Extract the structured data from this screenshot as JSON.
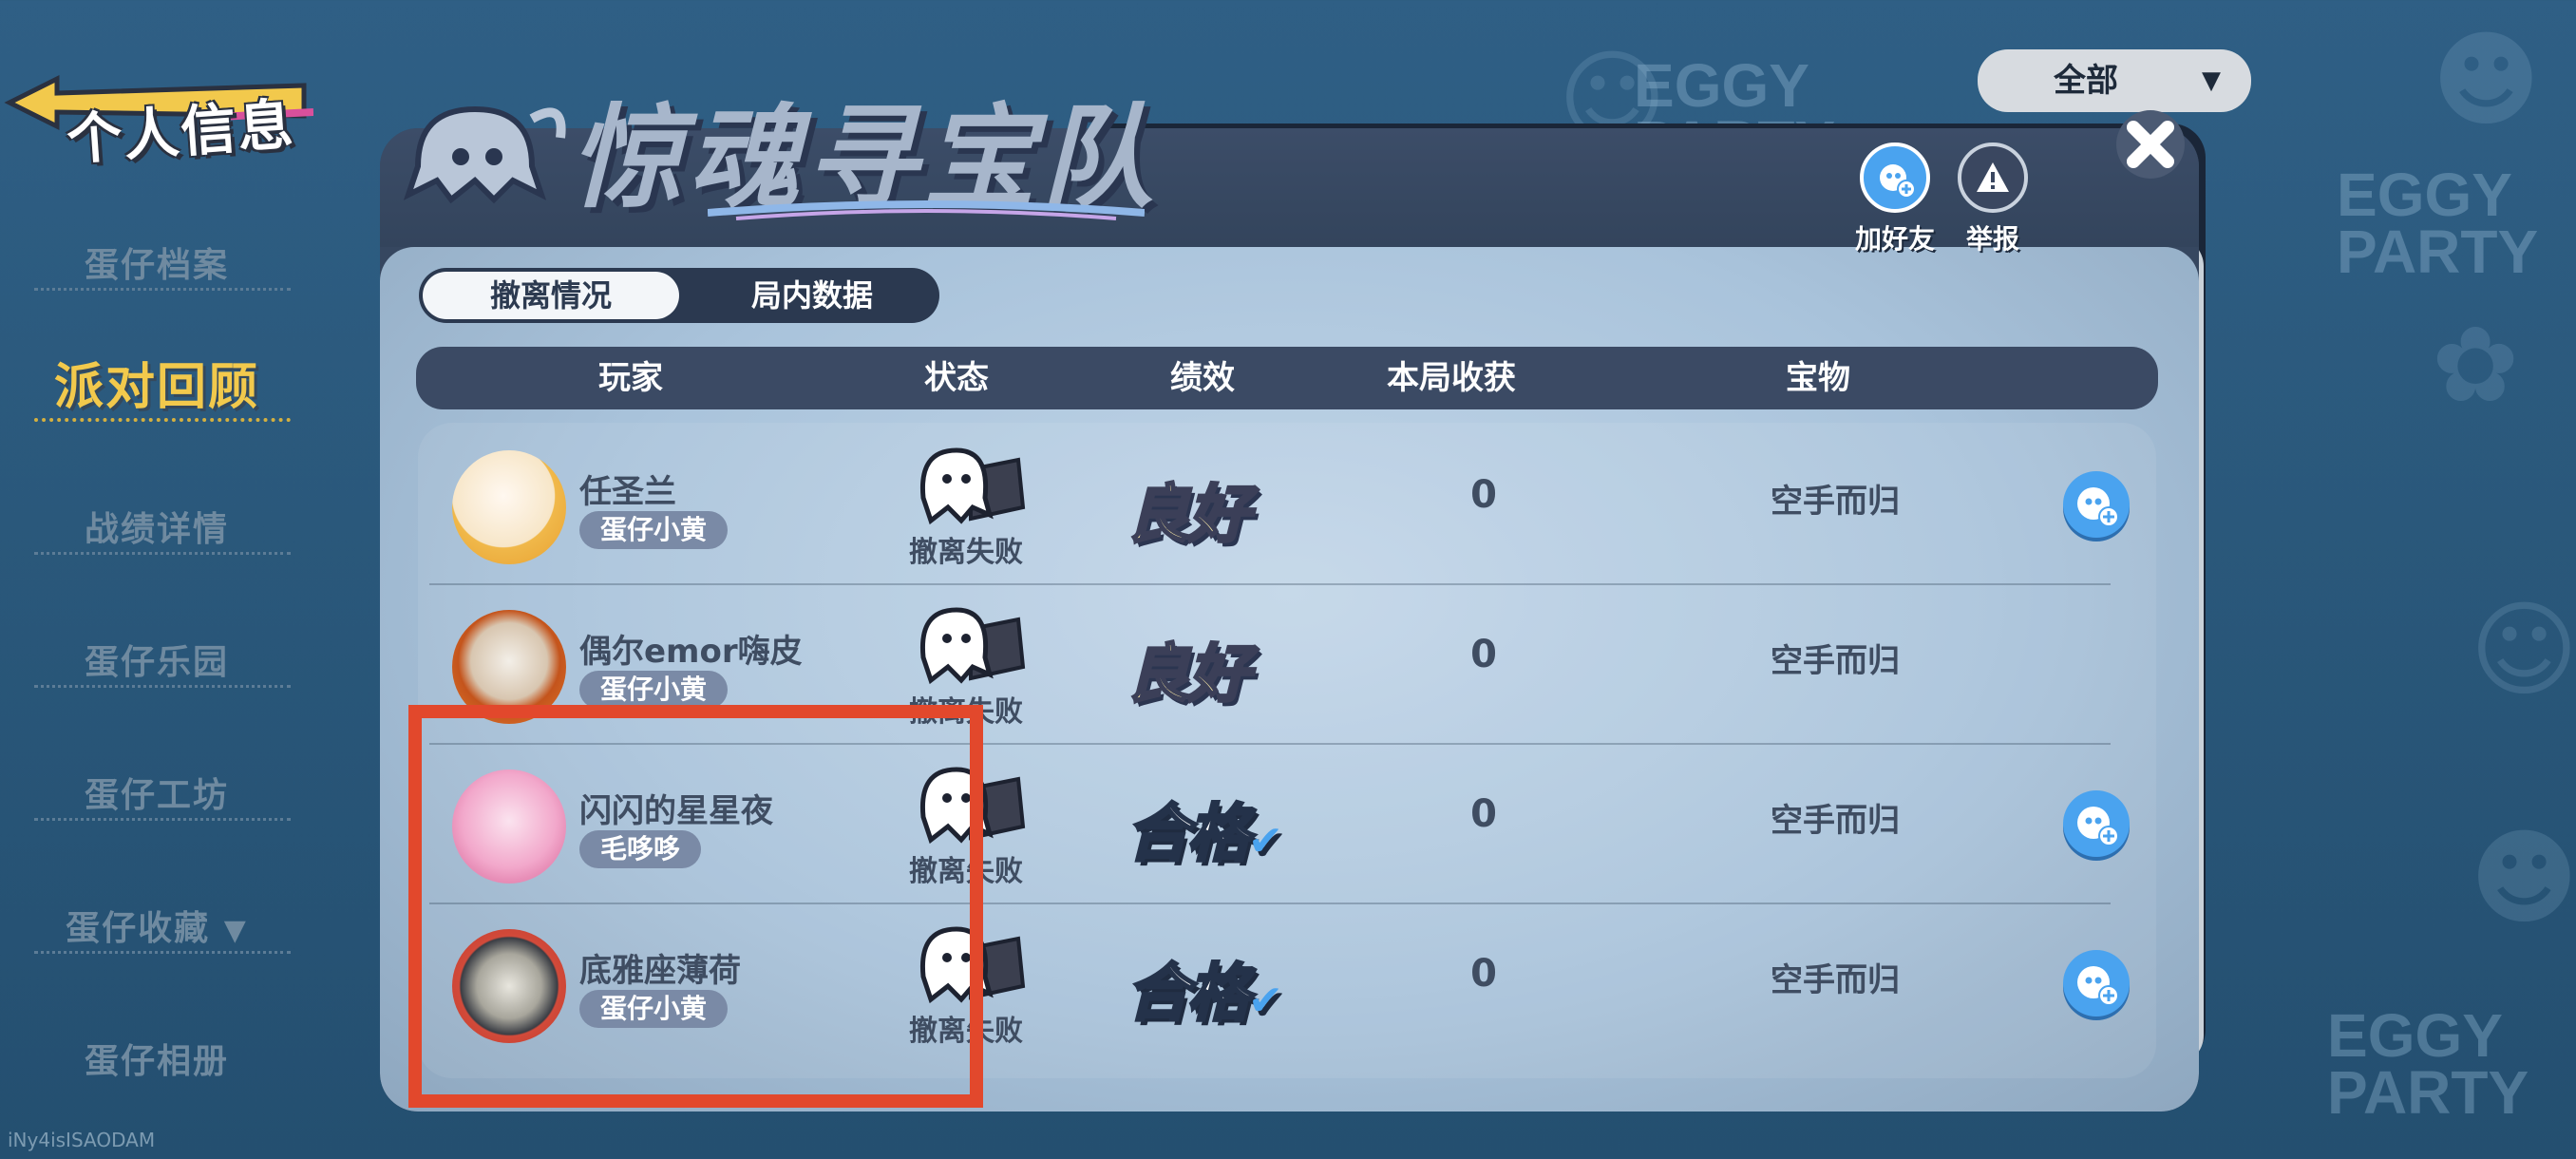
{
  "header": {
    "back_label": "个人信息",
    "game_title": "惊魂寻宝队",
    "filter": {
      "selected": "全部"
    }
  },
  "sidebar": {
    "items": [
      {
        "label": "蛋仔档案",
        "active": false
      },
      {
        "label": "派对回顾",
        "active": true
      },
      {
        "label": "战绩详情",
        "active": false
      },
      {
        "label": "蛋仔乐园",
        "active": false
      },
      {
        "label": "蛋仔工坊",
        "active": false
      },
      {
        "label": "蛋仔收藏",
        "active": false
      },
      {
        "label": "蛋仔相册",
        "active": false
      }
    ]
  },
  "dialog": {
    "actions": {
      "add_friend": "加好友",
      "report": "举报"
    },
    "tabs": [
      {
        "label": "撤离情况",
        "active": true
      },
      {
        "label": "局内数据",
        "active": false
      }
    ],
    "columns": {
      "player": "玩家",
      "status": "状态",
      "performance": "绩效",
      "harvest": "本局收获",
      "treasure": "宝物"
    },
    "rows": [
      {
        "name": "任圣兰",
        "tag": "蛋仔小黄",
        "status": "撤离失败",
        "performance": "良好",
        "harvest": "0",
        "treasure": "空手而归",
        "add_friend": true
      },
      {
        "name": "偶尔emor嗨皮",
        "tag": "蛋仔小黄",
        "status": "撤离失败",
        "performance": "良好",
        "harvest": "0",
        "treasure": "空手而归",
        "add_friend": false
      },
      {
        "name": "闪闪的星星夜",
        "tag": "毛哆哆",
        "status": "撤离失败",
        "performance": "合格",
        "harvest": "0",
        "treasure": "空手而归",
        "add_friend": true
      },
      {
        "name": "底雅座薄荷",
        "tag": "蛋仔小黄",
        "status": "撤离失败",
        "performance": "合格",
        "harvest": "0",
        "treasure": "空手而归",
        "add_friend": true
      }
    ]
  },
  "footer": {
    "watermark": "iNy4isISAODAM"
  },
  "background": {
    "brand_text": [
      "EGGY PARTY",
      "EGGY PARTY",
      "EGGY PARTY"
    ]
  },
  "colors": {
    "highlight": "#e2482c",
    "accent_blue": "#4aa3ef",
    "active_side": "#f2c94c"
  }
}
